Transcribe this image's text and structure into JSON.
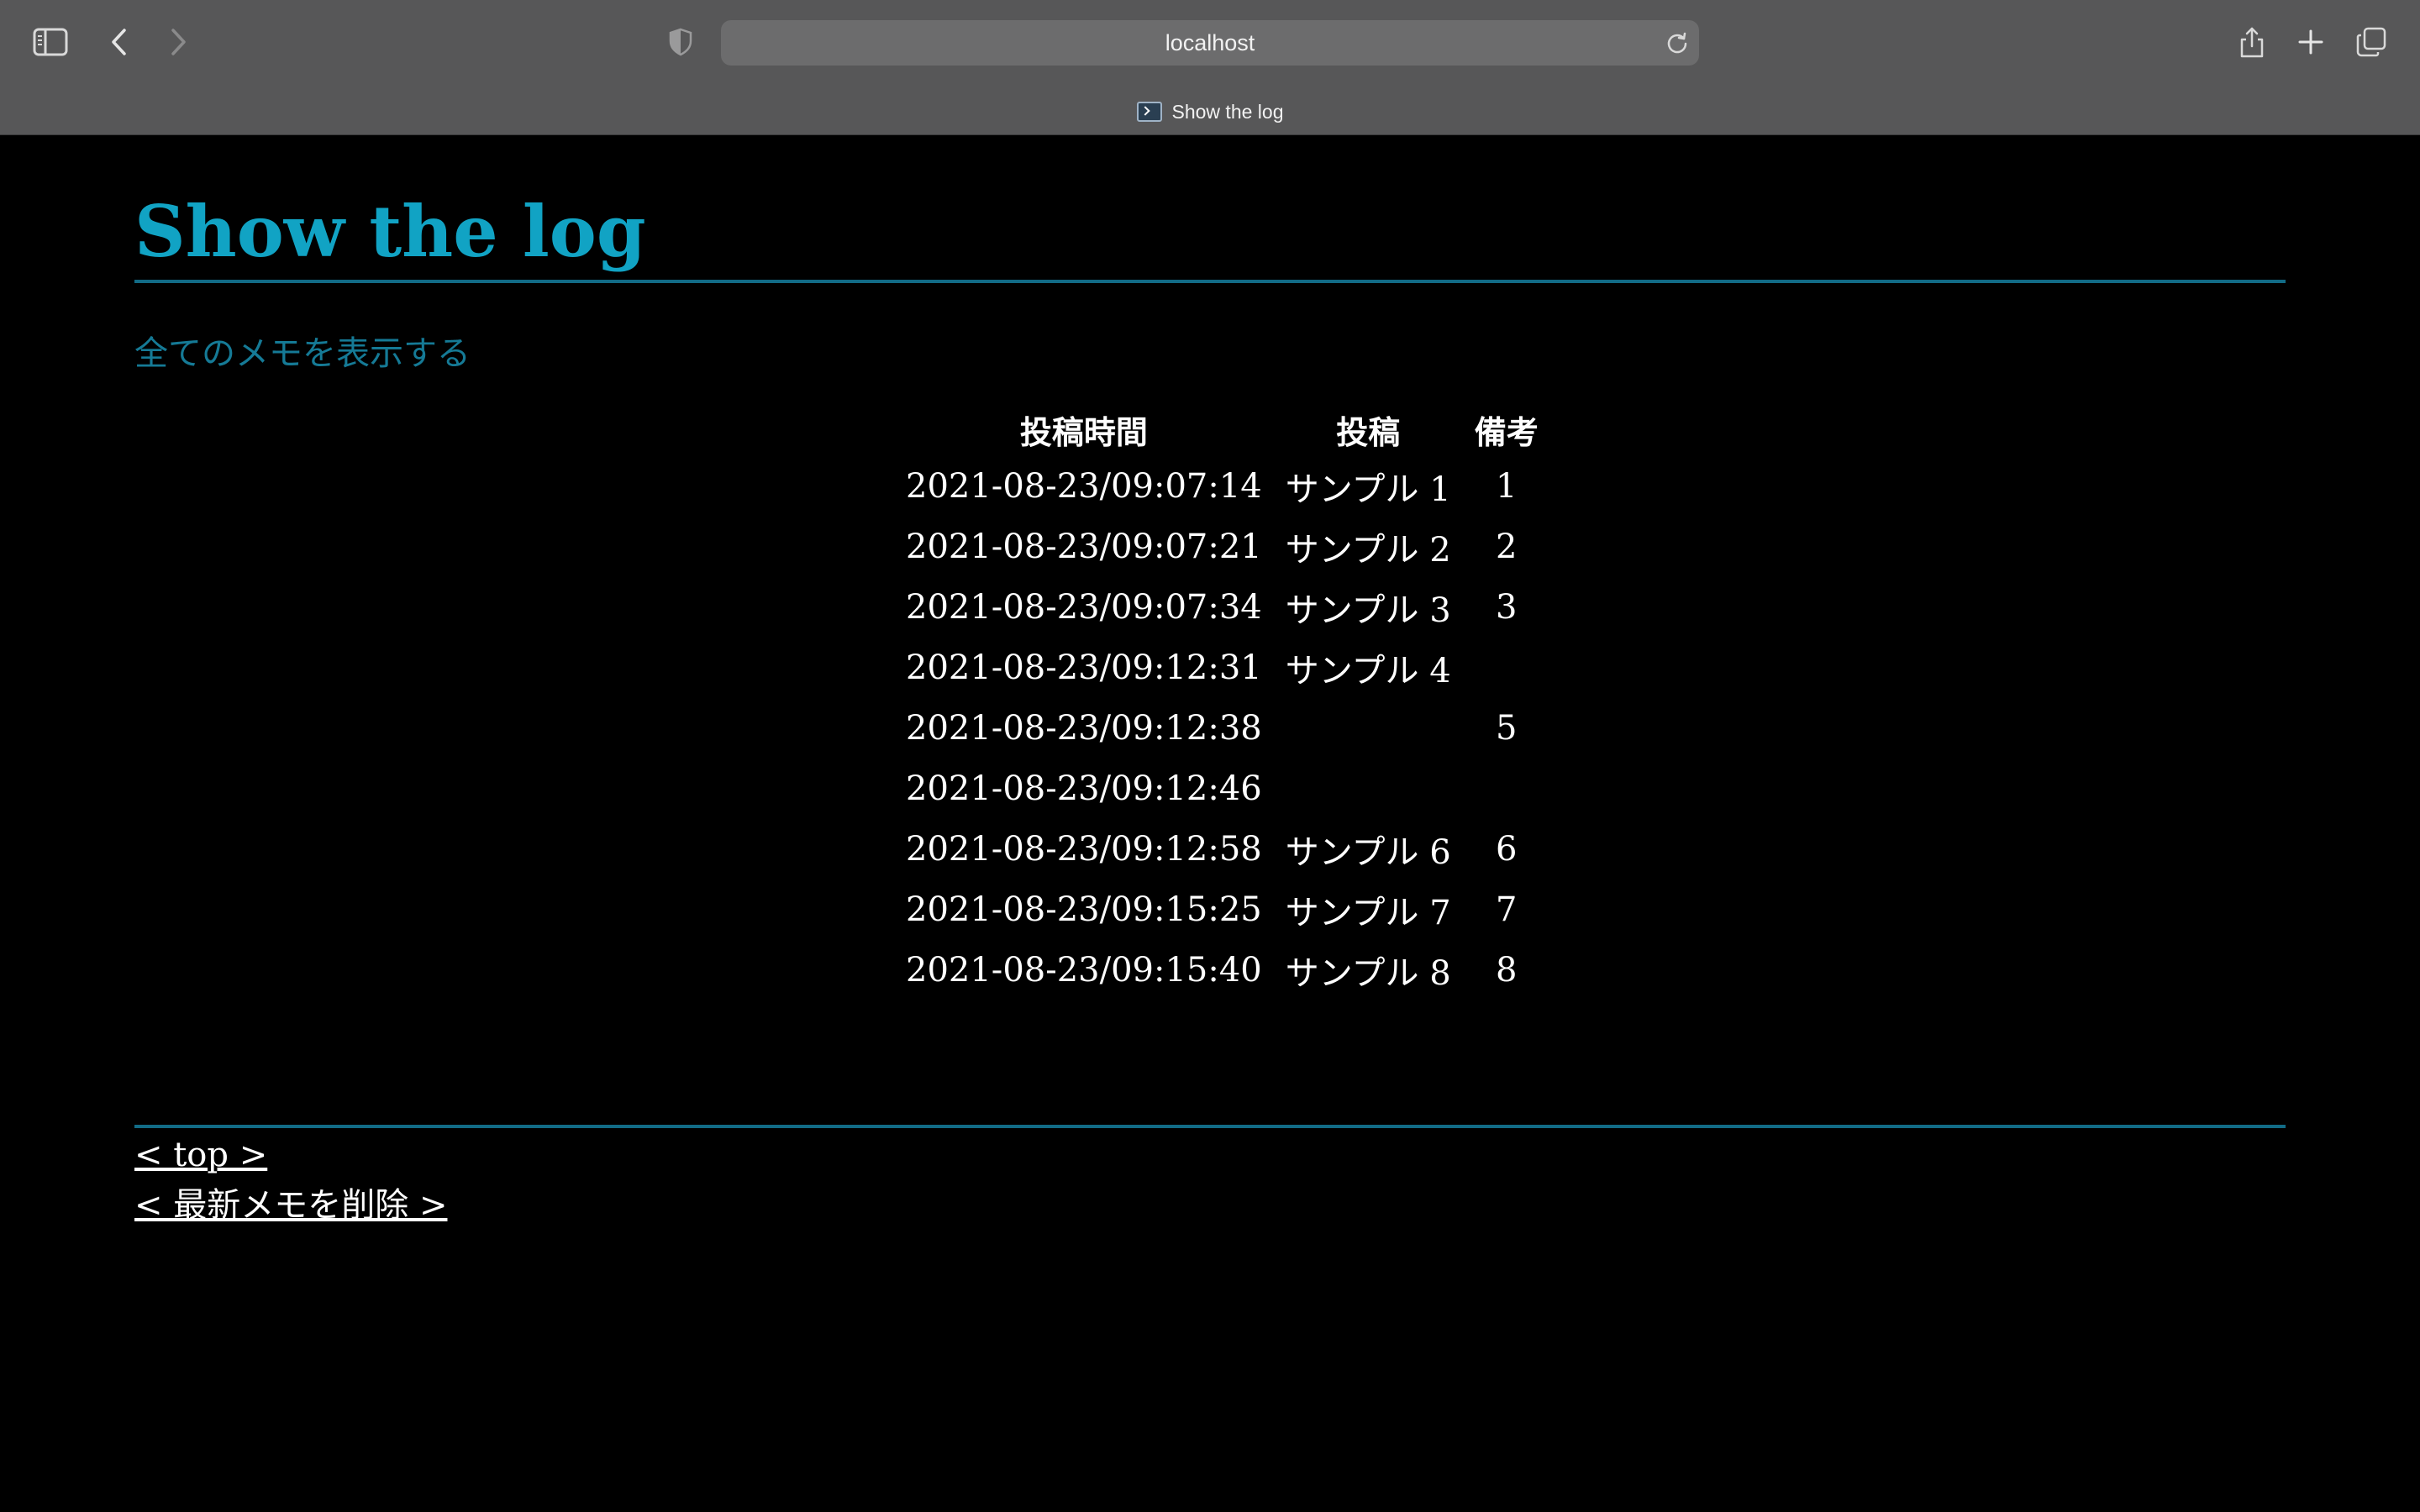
{
  "browser": {
    "url": "localhost",
    "tab_title": "Show the log"
  },
  "page": {
    "title": "Show the log",
    "show_all_link": "全てのメモを表示する",
    "table": {
      "headers": [
        "投稿時間",
        "投稿",
        "備考"
      ],
      "rows": [
        [
          "2021-08-23/09:07:14",
          "サンプル 1",
          "1"
        ],
        [
          "2021-08-23/09:07:21",
          "サンプル 2",
          "2"
        ],
        [
          "2021-08-23/09:07:34",
          "サンプル 3",
          "3"
        ],
        [
          "2021-08-23/09:12:31",
          "サンプル 4",
          ""
        ],
        [
          "2021-08-23/09:12:38",
          "",
          "5"
        ],
        [
          "2021-08-23/09:12:46",
          "",
          ""
        ],
        [
          "2021-08-23/09:12:58",
          "サンプル 6",
          "6"
        ],
        [
          "2021-08-23/09:15:25",
          "サンプル 7",
          "7"
        ],
        [
          "2021-08-23/09:15:40",
          "サンプル 8",
          "8"
        ]
      ]
    },
    "footer_links": [
      "< top >",
      "< 最新メモを削除 >"
    ]
  },
  "colors": {
    "title": "#11a3c4",
    "rule": "#126b86",
    "link": "#157a96",
    "background": "#000000",
    "chrome": "#575758"
  }
}
